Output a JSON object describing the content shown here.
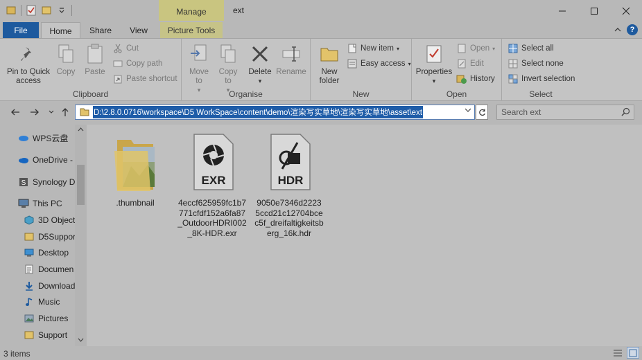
{
  "window": {
    "title": "ext",
    "manage_label": "Manage",
    "controls": [
      "minimize",
      "maximize",
      "close"
    ]
  },
  "tabs": {
    "file": "File",
    "home": "Home",
    "share": "Share",
    "view": "View",
    "picture_tools": "Picture Tools"
  },
  "ribbon": {
    "clipboard": {
      "label": "Clipboard",
      "pin_to_quick_access": "Pin to Quick access",
      "copy": "Copy",
      "paste": "Paste",
      "cut": "Cut",
      "copy_path": "Copy path",
      "paste_shortcut": "Paste shortcut"
    },
    "organise": {
      "label": "Organise",
      "move_to": "Move to",
      "copy_to": "Copy to",
      "delete": "Delete",
      "rename": "Rename"
    },
    "new": {
      "label": "New",
      "new_folder": "New folder",
      "new_item": "New item",
      "easy_access": "Easy access"
    },
    "open": {
      "label": "Open",
      "properties": "Properties",
      "open": "Open",
      "edit": "Edit",
      "history": "History"
    },
    "select": {
      "label": "Select",
      "select_all": "Select all",
      "select_none": "Select none",
      "invert_selection": "Invert selection"
    }
  },
  "address": {
    "path": "D:\\2.8.0.0716\\workspace\\D5 WorkSpace\\content\\demo\\渲染写实草地\\渲染写实草地\\asset\\ext",
    "search_placeholder": "Search ext"
  },
  "nav_pane": {
    "items": [
      {
        "label": "WPS云盘",
        "icon": "cloud-icon"
      },
      {
        "label": "OneDrive - ",
        "icon": "onedrive-icon"
      },
      {
        "label": "Synology D",
        "icon": "synology-icon"
      },
      {
        "label": "This PC",
        "icon": "computer-icon"
      },
      {
        "label": "3D Object",
        "icon": "cube-icon"
      },
      {
        "label": "D5Suppor",
        "icon": "folder-icon"
      },
      {
        "label": "Desktop",
        "icon": "desktop-icon"
      },
      {
        "label": "Documen",
        "icon": "document-icon"
      },
      {
        "label": "Download",
        "icon": "download-icon"
      },
      {
        "label": "Music",
        "icon": "music-icon"
      },
      {
        "label": "Pictures",
        "icon": "pictures-icon"
      },
      {
        "label": "Support",
        "icon": "folder-icon"
      }
    ]
  },
  "files": [
    {
      "name": ".thumbnail",
      "type": "folder"
    },
    {
      "name": "4eccf625959fc1b7771cfdf152a6fa87_OutdoorHDRI002_8K-HDR.exr",
      "type": "exr",
      "badge": "EXR"
    },
    {
      "name": "9050e7346d22235ccd21c12704bcec5f_dreifaltigkeitsberg_16k.hdr",
      "type": "hdr",
      "badge": "HDR"
    }
  ],
  "status": {
    "item_count": "3 items"
  },
  "colors": {
    "accent": "#1e5a9e",
    "manage_tab": "#c9c580",
    "selection": "#1e5ca8"
  }
}
